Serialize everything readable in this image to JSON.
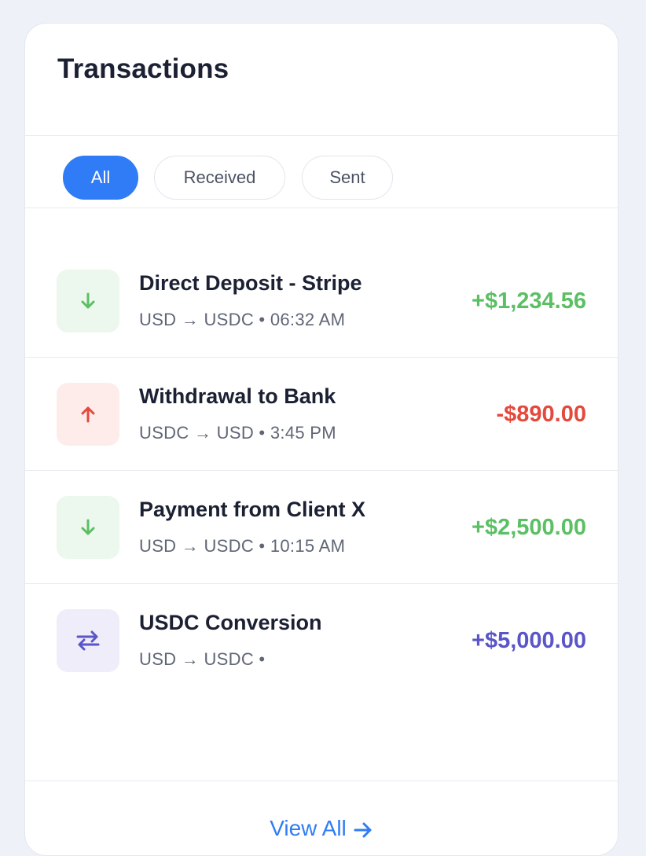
{
  "header": {
    "title": "Transactions"
  },
  "filters": [
    {
      "label": "All",
      "active": true
    },
    {
      "label": "Received",
      "active": false
    },
    {
      "label": "Sent",
      "active": false
    }
  ],
  "transactions": [
    {
      "name": "Direct Deposit - Stripe",
      "meta": "USD → USDC • 06:32 AM",
      "amount": "+$1,234.56",
      "direction": "in",
      "icon": "arrow-down-icon",
      "color": "#5bbf64"
    },
    {
      "name": "Withdrawal to Bank",
      "meta": "USDC → USD • 3:45 PM",
      "amount": "-$890.00",
      "direction": "out",
      "icon": "arrow-up-icon",
      "color": "#e5483c"
    },
    {
      "name": "Payment from Client X",
      "meta": "USD → USDC • 10:15 AM",
      "amount": "+$2,500.00",
      "direction": "in",
      "icon": "arrow-down-icon",
      "color": "#5bbf64"
    },
    {
      "name": "USDC Conversion",
      "meta": "USD → USDC •",
      "amount": "+$5,000.00",
      "direction": "swap",
      "icon": "swap-arrows-icon",
      "color": "#5a55c8"
    }
  ],
  "footer": {
    "view_all_label": "View All",
    "icon": "arrow-right-icon"
  },
  "colors": {
    "accent": "#2f7cf6",
    "positive": "#5bbf64",
    "negative": "#e5483c",
    "conversion": "#5a55c8"
  }
}
